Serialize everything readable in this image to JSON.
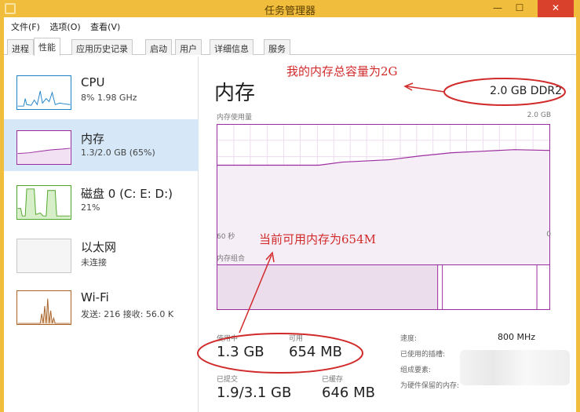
{
  "window": {
    "title": "任务管理器"
  },
  "menu": [
    "文件(F)",
    "选项(O)",
    "查看(V)"
  ],
  "tabs": [
    "进程",
    "性能",
    "应用历史记录",
    "启动",
    "用户",
    "详细信息",
    "服务"
  ],
  "sidebar": {
    "cpu": {
      "name": "CPU",
      "detail": "8% 1.98 GHz"
    },
    "memory": {
      "name": "内存",
      "detail": "1.3/2.0 GB (65%)"
    },
    "disk": {
      "name": "磁盘 0 (C: E: D:)",
      "detail": "21%"
    },
    "ethernet": {
      "name": "以太网",
      "detail": "未连接"
    },
    "wifi": {
      "name": "Wi-Fi",
      "detail": "发送: 216 接收: 56.0 K"
    }
  },
  "main": {
    "title": "内存",
    "mem_type": "2.0 GB DDR2",
    "usage_label": "内存使用量",
    "usage_max": "2.0 GB",
    "time_left": "60 秒",
    "time_right": "0",
    "composition_label": "内存组合",
    "in_use_label": "使用中",
    "in_use_value": "1.3 GB",
    "available_label": "可用",
    "available_value": "654 MB",
    "committed_label": "已提交",
    "committed_value": "1.9/3.1 GB",
    "cached_label": "已缓存",
    "cached_value": "646 MB",
    "speed_label": "速度:",
    "speed_value": "800 MHz",
    "slots_label": "已使用的插槽:",
    "form_label": "组成要素:",
    "reserved_label": "为硬件保留的内存:"
  },
  "annotations": {
    "total": "我的内存总容量为2G",
    "available": "当前可用内存为654M"
  },
  "colors": {
    "title_bar": "#f0be3c",
    "close_button": "#d9412c",
    "memory_accent": "#9b2c9f",
    "cpu_accent": "#1e82c8",
    "disk_accent": "#4fa42a",
    "wifi_accent": "#a8632a",
    "annotation": "#d12a2a"
  }
}
